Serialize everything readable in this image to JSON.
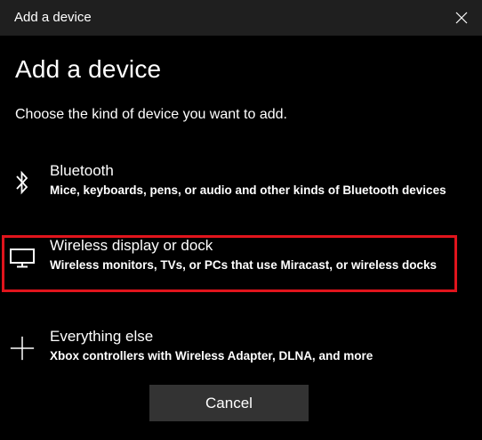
{
  "window": {
    "title": "Add a device"
  },
  "main": {
    "heading": "Add a device",
    "subheading": "Choose the kind of device you want to add.",
    "options": [
      {
        "icon": "bluetooth-icon",
        "title": "Bluetooth",
        "description": "Mice, keyboards, pens, or audio and other kinds of Bluetooth devices"
      },
      {
        "icon": "monitor-icon",
        "title": "Wireless display or dock",
        "description": "Wireless monitors, TVs, or PCs that use Miracast, or wireless docks",
        "highlighted": true
      },
      {
        "icon": "plus-icon",
        "title": "Everything else",
        "description": "Xbox controllers with Wireless Adapter, DLNA, and more"
      }
    ]
  },
  "footer": {
    "cancel_label": "Cancel"
  },
  "colors": {
    "background": "#000000",
    "titlebar": "#1f1f1f",
    "button": "#333333",
    "highlight": "#e0141c",
    "text": "#ffffff"
  }
}
